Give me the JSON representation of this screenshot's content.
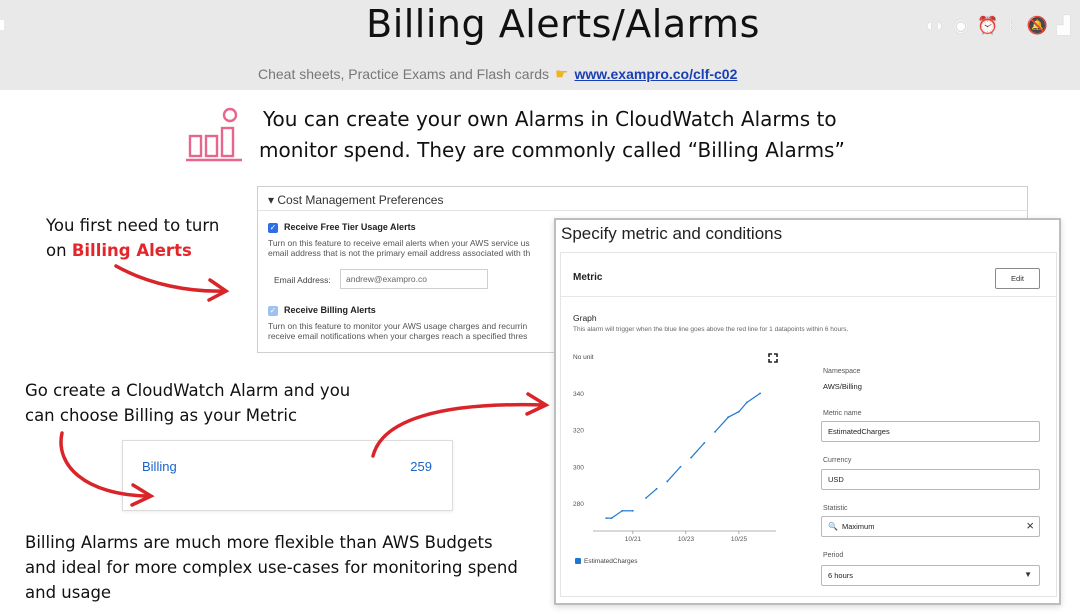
{
  "header": {
    "title": "Billing Alerts/Alarms",
    "subtitle_text": "Cheat sheets, Practice Exams and Flash cards",
    "subtitle_link": "www.exampro.co/clf-c02"
  },
  "intro": {
    "line1": "You can create your own Alarms in CloudWatch Alarms to",
    "line2": "monitor spend. They are commonly called “Billing Alarms”"
  },
  "notes": {
    "first_prefix": "You first need to turn",
    "first_on": "on ",
    "first_highlight": "Billing Alerts",
    "second_line1": "Go create a CloudWatch Alarm and you",
    "second_line2": "can choose Billing as your Metric",
    "third_line1": "Billing Alarms are much more flexible than AWS Budgets",
    "third_line2": "and ideal for more complex use-cases for monitoring spend",
    "third_line3": "and usage"
  },
  "prefs": {
    "heading": "Cost Management Preferences",
    "free_tier_label": "Receive Free Tier Usage Alerts",
    "free_tier_desc1": "Turn on this feature to receive email alerts when your AWS service us",
    "free_tier_desc2": "email address that is not the primary email address associated with th",
    "email_label": "Email Address:",
    "email_value": "andrew@exampro.co",
    "billing_label": "Receive Billing Alerts",
    "billing_desc1": "Turn on this feature to monitor your AWS usage charges and recurrin",
    "billing_desc2": "receive email notifications when your charges reach a specified thres"
  },
  "metric_row": {
    "name": "Billing",
    "count": "259"
  },
  "panel": {
    "title": "Specify metric and conditions",
    "section": "Metric",
    "edit": "Edit",
    "graph_label": "Graph",
    "graph_desc": "This alarm will trigger when the blue line goes above the red line for 1 datapoints within 6 hours.",
    "no_unit": "No unit",
    "legend": "EstimatedCharges",
    "namespace_label": "Namespace",
    "namespace_value": "AWS/Billing",
    "metric_name_label": "Metric name",
    "metric_name_value": "EstimatedCharges",
    "currency_label": "Currency",
    "currency_value": "USD",
    "statistic_label": "Statistic",
    "statistic_value": "Maximum",
    "period_label": "Period",
    "period_value": "6 hours"
  },
  "chart_data": {
    "type": "line",
    "title": "",
    "ylabel": "No unit",
    "series": [
      {
        "name": "EstimatedCharges",
        "x": [
          20.0,
          20.2,
          20.6,
          21.0,
          21.5,
          21.9,
          22.3,
          22.8,
          23.2,
          23.7,
          24.1,
          24.6,
          25.0,
          25.3,
          25.8
        ],
        "values": [
          272,
          272,
          276,
          276,
          283,
          288,
          292,
          300,
          305,
          313,
          319,
          327,
          330,
          335,
          340
        ]
      }
    ],
    "xticks": [
      "10/21",
      "10/23",
      "10/25"
    ],
    "yticks": [
      280,
      300,
      320,
      340
    ],
    "ylim": [
      265,
      350
    ],
    "grid": false,
    "colors": {
      "line": "#1f77d3"
    }
  },
  "colors": {
    "highlight": "#e3262b",
    "link": "#1a3fb5",
    "accent": "#e8658c",
    "arrow": "#d9252a"
  }
}
